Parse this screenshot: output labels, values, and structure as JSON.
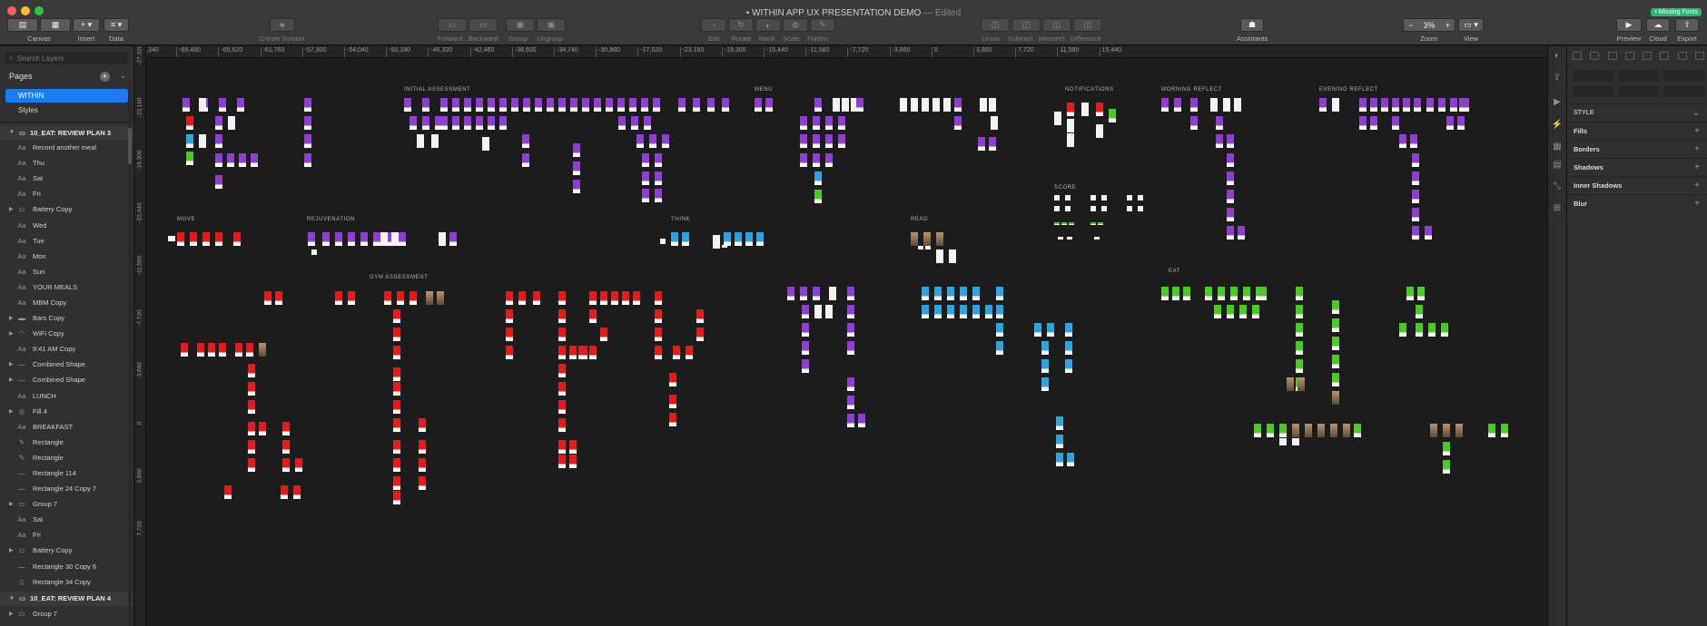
{
  "window": {
    "title": "WITHIN APP UX PRESENTATION DEMO",
    "edited": "— Edited",
    "missing_fonts": "• Missing Fonts"
  },
  "toolbar": {
    "canvas": "Canvas",
    "insert": "Insert",
    "data": "Data",
    "create_symbol": "Create Symbol",
    "forward": "Forward",
    "backward": "Backward",
    "group": "Group",
    "ungroup": "Ungroup",
    "edit": "Edit",
    "rotate": "Rotate",
    "mask": "Mask",
    "scale": "Scale",
    "flatten": "Flatten",
    "union": "Union",
    "subtract": "Subtract",
    "intersect": "Intersect",
    "difference": "Difference",
    "assistants": "Assistants",
    "zoom_value": "3%",
    "zoom": "Zoom",
    "view": "View",
    "preview": "Preview",
    "cloud": "Cloud",
    "export": "Export"
  },
  "sidebar": {
    "search_placeholder": "Search Layers",
    "pages_title": "Pages",
    "pages": [
      "WITHIN",
      "Styles"
    ],
    "artboard_1": "10_EAT: REVIEW PLAN 3",
    "artboard_2": "10_EAT: REVIEW PLAN 4",
    "layers": [
      {
        "name": "Record another meal",
        "icon": "text-layer-icon",
        "glyph": "Aa",
        "disc": false
      },
      {
        "name": "Thu",
        "icon": "text-layer-icon",
        "glyph": "Aa",
        "disc": false
      },
      {
        "name": "Sat",
        "icon": "text-layer-icon",
        "glyph": "Aa",
        "disc": false
      },
      {
        "name": "Fri",
        "icon": "text-layer-icon",
        "glyph": "Aa",
        "disc": false
      },
      {
        "name": "Battery Copy",
        "icon": "battery-icon",
        "glyph": "▭",
        "disc": true
      },
      {
        "name": "Wed",
        "icon": "text-layer-icon",
        "glyph": "Aa",
        "disc": false
      },
      {
        "name": "Tue",
        "icon": "text-layer-icon",
        "glyph": "Aa",
        "disc": false
      },
      {
        "name": "Mon",
        "icon": "text-layer-icon",
        "glyph": "Aa",
        "disc": false
      },
      {
        "name": "Sun",
        "icon": "text-layer-icon",
        "glyph": "Aa",
        "disc": false
      },
      {
        "name": "YOUR MEALS",
        "icon": "text-layer-icon",
        "glyph": "Aa",
        "disc": false
      },
      {
        "name": "MBM Copy",
        "icon": "text-layer-icon",
        "glyph": "Aa",
        "disc": false
      },
      {
        "name": "Bars Copy",
        "icon": "bars-icon",
        "glyph": "▬",
        "disc": true
      },
      {
        "name": "WiFi Copy",
        "icon": "wifi-icon",
        "glyph": "◠",
        "disc": true
      },
      {
        "name": "9:41 AM Copy",
        "icon": "text-layer-icon",
        "glyph": "Aa",
        "disc": false
      },
      {
        "name": "Combined Shape",
        "icon": "shape-icon",
        "glyph": "—",
        "disc": true
      },
      {
        "name": "Combined Shape",
        "icon": "shape-icon",
        "glyph": "—",
        "disc": true
      },
      {
        "name": "LUNCH",
        "icon": "text-layer-icon",
        "glyph": "Aa",
        "disc": false
      },
      {
        "name": "Fill 4",
        "icon": "fill-shape-icon",
        "glyph": "◎",
        "disc": true
      },
      {
        "name": "BREAKFAST",
        "icon": "text-layer-icon",
        "glyph": "Aa",
        "disc": false
      },
      {
        "name": "Rectangle",
        "icon": "pencil-path-icon",
        "glyph": "✎",
        "disc": false
      },
      {
        "name": "Rectangle",
        "icon": "pencil-path-icon",
        "glyph": "✎",
        "disc": false
      },
      {
        "name": "Rectangle 114",
        "icon": "line-shape-icon",
        "glyph": "—",
        "disc": false
      },
      {
        "name": "Rectangle 24 Copy 7",
        "icon": "line-shape-icon",
        "glyph": "—",
        "disc": false
      },
      {
        "name": "Group 7",
        "icon": "folder-icon",
        "glyph": "▭",
        "disc": true
      },
      {
        "name": "Sat",
        "icon": "text-layer-icon",
        "glyph": "Aa",
        "disc": false
      },
      {
        "name": "Fri",
        "icon": "text-layer-icon",
        "glyph": "Aa",
        "disc": false
      },
      {
        "name": "Battery Copy",
        "icon": "battery-icon",
        "glyph": "▭",
        "disc": true
      },
      {
        "name": "Rectangle 30 Copy 6",
        "icon": "line-shape-icon",
        "glyph": "—",
        "disc": false
      },
      {
        "name": "Rectangle 34 Copy",
        "icon": "vertical-rect-icon",
        "glyph": "▯",
        "disc": false
      }
    ],
    "last_layer": "Group 7"
  },
  "ruler": {
    "top": [
      "-73,340",
      "-69,480",
      "-65,620",
      "-61,760",
      "-57,900",
      "-54,040",
      "-50,180",
      "-46,320",
      "-42,460",
      "-38,600",
      "-34,740",
      "-30,880",
      "-27,020",
      "-23,160",
      "-19,300",
      "-15,440",
      "-11,580",
      "-7,720",
      "-3,860",
      "0",
      "3,860",
      "7,720",
      "11,580",
      "15,440"
    ],
    "left": [
      "-27,020",
      "-23,160",
      "-19,300",
      "-15,440",
      "-11,580",
      "-7,720",
      "-3,860",
      "0",
      "3,860",
      "7,720"
    ]
  },
  "canvas": {
    "sections": [
      "INITIAL ASSESSMENT",
      "MENU",
      "NOTIFICATIONS",
      "MORNING REFLECT",
      "EVENING REFLECT",
      "SCORE",
      "MOVE",
      "REJUVENATION",
      "THINK",
      "READ",
      "GYM ASSESSMENT",
      "EAT"
    ],
    "colors": {
      "purple": "#8e3fd0",
      "red": "#e51b1b",
      "blue": "#2fa3df",
      "green": "#4cc922",
      "white": "#f2f2f2",
      "photo": "#b89570"
    }
  },
  "inspector": {
    "style": "STYLE",
    "sections": [
      "Fills",
      "Borders",
      "Shadows",
      "Inner Shadows",
      "Blur"
    ]
  }
}
